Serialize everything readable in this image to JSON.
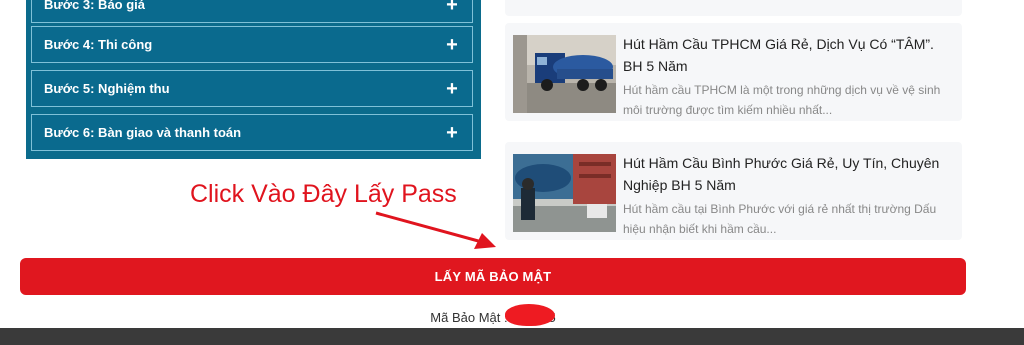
{
  "accordion": {
    "items": [
      {
        "label": "Bước 3: Báo giá",
        "icon": "plus-icon"
      },
      {
        "label": "Bước 4: Thi công",
        "icon": "plus-icon"
      },
      {
        "label": "Bước 5: Nghiệm thu",
        "icon": "plus-icon"
      },
      {
        "label": "Bước 6: Bàn giao và thanh toán",
        "icon": "plus-icon"
      }
    ],
    "plus_symbol": "+"
  },
  "posts": [
    {
      "title": "Hút Hầm Cầu TPHCM Giá Rẻ, Dịch Vụ Có “TÂM”. BH 5 Năm",
      "excerpt": "Hút hầm cầu TPHCM là một trong những dịch vụ về vệ sinh môi trường được tìm kiếm nhiều nhất..."
    },
    {
      "title": "Hút Hầm Cầu Bình Phước Giá Rẻ, Uy Tín, Chuyên Nghiệp BH 5 Năm",
      "excerpt": " Hút hầm cầu tại Bình Phước với giá rẻ nhất thị trường Dấu hiệu nhận biết khi hầm cầu..."
    }
  ],
  "annotation": {
    "text": "Click Vào Đây Lấy Pass",
    "color": "#e0141e"
  },
  "security_button": {
    "label": "LẤY MÃ BẢO MẬT",
    "color": "#e0171f"
  },
  "security_code": {
    "label": "Mã Bảo Mật : ",
    "visible_start": "6",
    "visible_end": "5"
  }
}
